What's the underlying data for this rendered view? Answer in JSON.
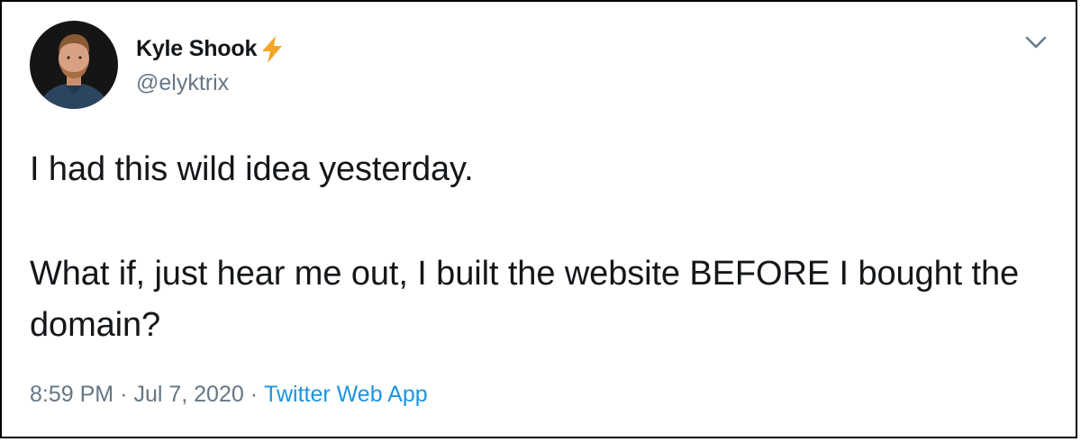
{
  "author": {
    "display_name": "Kyle Shook",
    "handle": "@elyktrix",
    "emoji_icon": "lightning-bolt"
  },
  "tweet": {
    "paragraphs": [
      "I had this wild idea yesterday.",
      "What if, just hear me out, I built the website BEFORE I bought the domain?"
    ]
  },
  "meta": {
    "time": "8:59 PM",
    "date": "Jul 7, 2020",
    "separator": "·",
    "source": "Twitter Web App"
  },
  "colors": {
    "text": "#14171a",
    "muted": "#657786",
    "link": "#1b95e0",
    "lightning": "#f4a623"
  }
}
